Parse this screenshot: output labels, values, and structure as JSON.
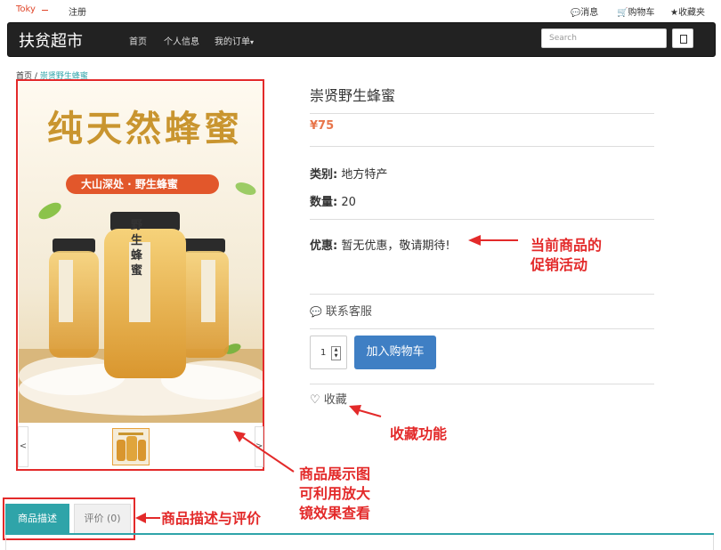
{
  "topbar": {
    "user": "Toky",
    "register": "注册",
    "messages": "消息",
    "cart": "购物车",
    "favorites": "收藏夹"
  },
  "navbar": {
    "brand": "扶贫超市",
    "links": [
      "首页",
      "个人信息",
      "我的订单"
    ],
    "dropdown_caret": "▾",
    "search_placeholder": "Search"
  },
  "breadcrumb": {
    "home": "首页",
    "separator": "/",
    "current": "崇贤野生蜂蜜"
  },
  "product": {
    "name": "崇贤野生蜂蜜",
    "price": "¥75",
    "category_label": "类别:",
    "category": "地方特产",
    "quantity_label": "数量:",
    "quantity": "20",
    "promo_label": "优惠:",
    "promo": "暂无优惠，敬请期待!",
    "service": "联系客服",
    "qty_value": "1",
    "add_to_cart": "加入购物车",
    "favorite": "收藏"
  },
  "image": {
    "headline": "纯天然蜂蜜",
    "banner": "大山深处 · 野生蜂蜜",
    "jar_label": "野生蜂蜜",
    "prev": "<",
    "next": ">"
  },
  "tabs": [
    {
      "label": "商品描述"
    },
    {
      "label": "评价 (0)"
    }
  ],
  "annotations": {
    "promo": "当前商品的\n促销活动",
    "favorite": "收藏功能",
    "gallery": "商品展示图\n可利用放大\n镜效果查看",
    "tabs": "商品描述与评价"
  },
  "colors": {
    "accent_teal": "#2fa4a9",
    "price": "#e8754a",
    "button_blue": "#3f7fc4",
    "annotation_red": "#e32a2a",
    "navbar": "#222222"
  }
}
